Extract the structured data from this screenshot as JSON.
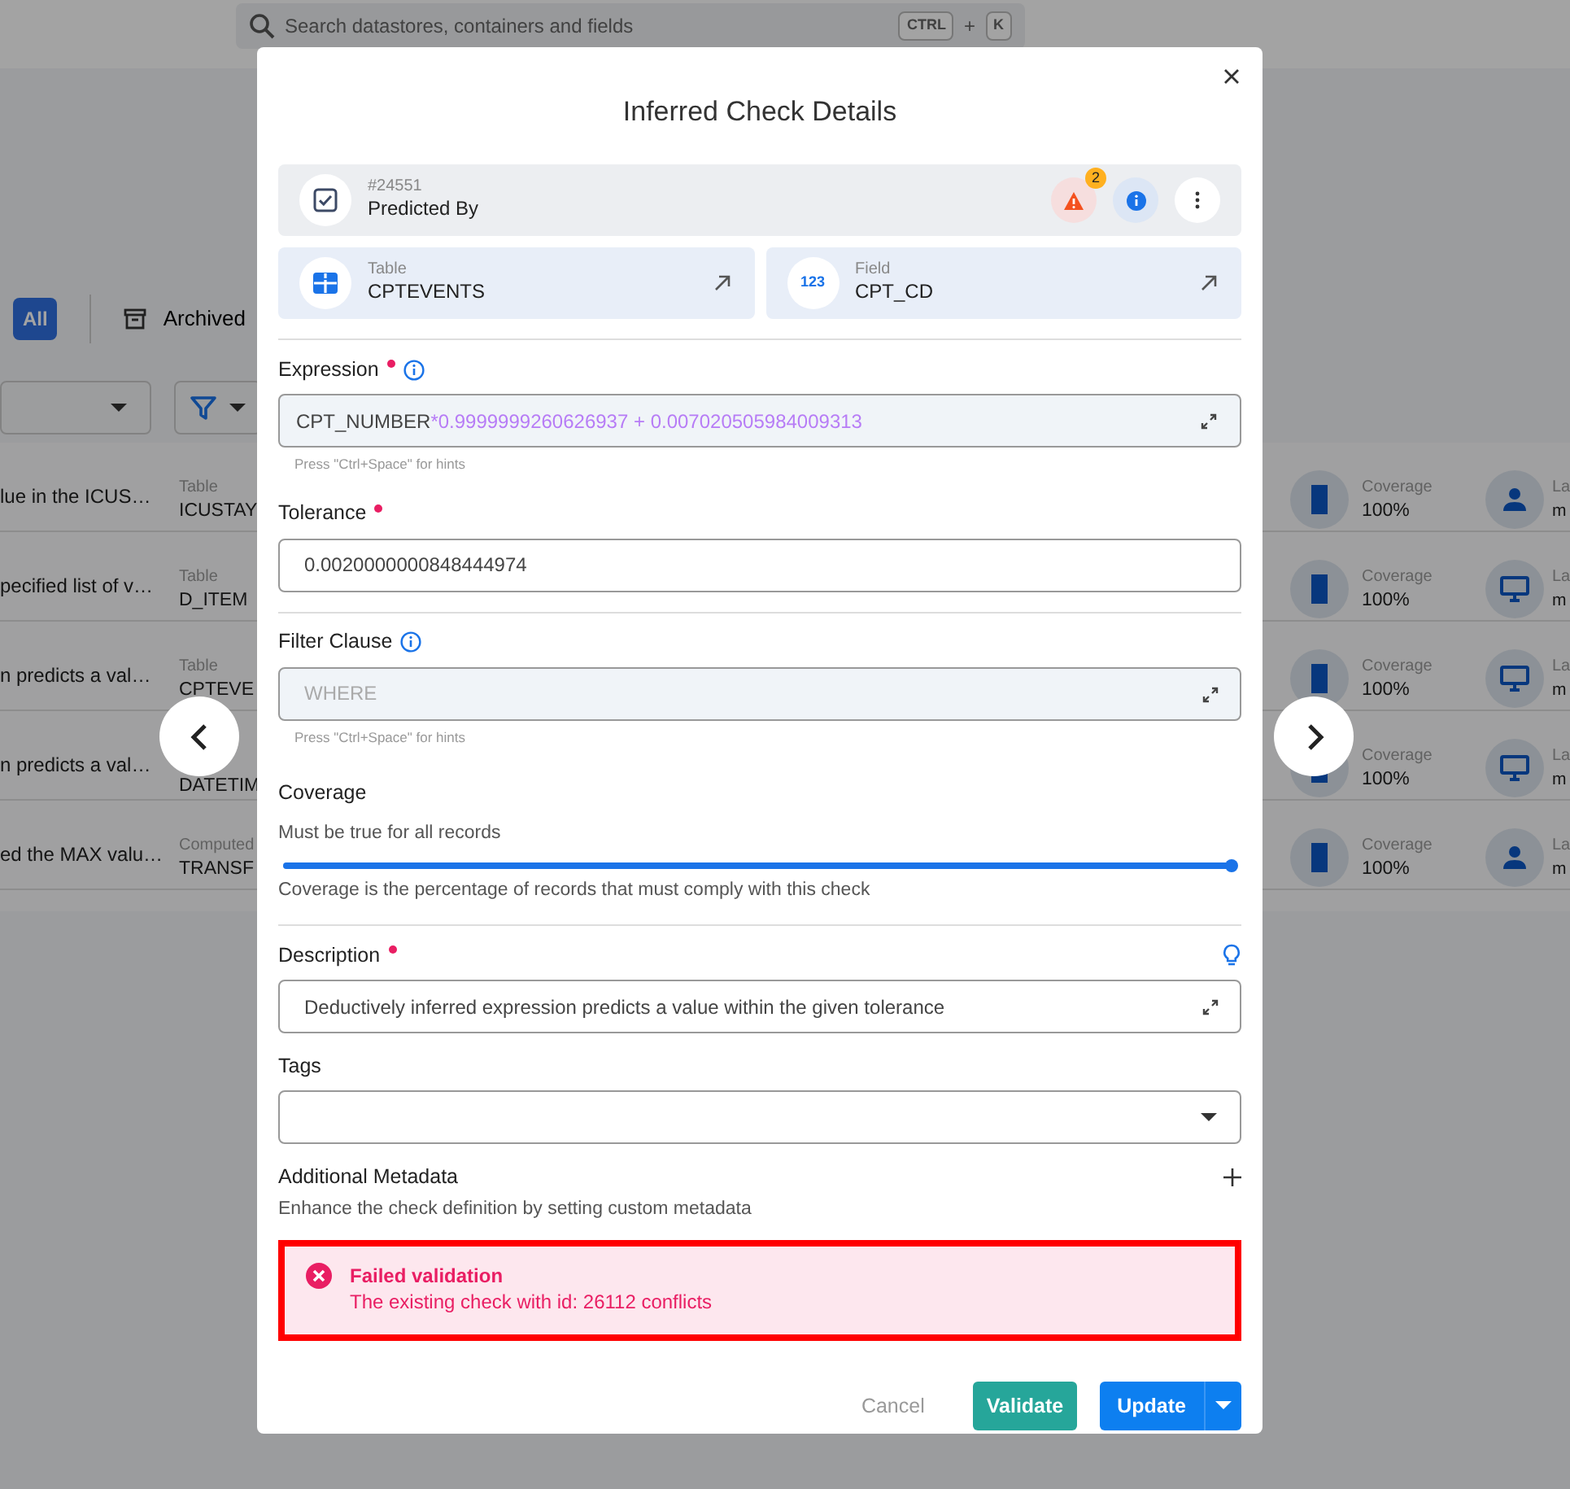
{
  "background": {
    "search": {
      "placeholder": "Search datastores, containers and fields",
      "keys": [
        "CTRL",
        "K"
      ],
      "joiner": "+"
    },
    "filters": [
      {
        "label": "All",
        "kind": "pill",
        "selected": true
      },
      {
        "label": "Archived",
        "kind": "archive",
        "selected": false
      }
    ],
    "rows": [
      {
        "kind": "person",
        "description": "lue in the ICUS…",
        "container_type": "Table",
        "container": "ICUSTAY",
        "coverage_label": "Coverage",
        "coverage": "100%",
        "user_label": "La",
        "user_value": "m"
      },
      {
        "kind": "monitor",
        "description": "pecified list of v…",
        "container_type": "Table",
        "container": "D_ITEM",
        "coverage_label": "Coverage",
        "coverage": "100%",
        "user_label": "La",
        "user_value": "m"
      },
      {
        "kind": "monitor",
        "description": "n predicts a val…",
        "container_type": "Table",
        "container": "CPTEVE",
        "coverage_label": "Coverage",
        "coverage": "100%",
        "user_label": "La",
        "user_value": "m"
      },
      {
        "kind": "monitor",
        "description": "n predicts a val…",
        "container": "DATETIM",
        "coverage_label": "Coverage",
        "coverage": "100%",
        "user_label": "La",
        "user_value": "m"
      },
      {
        "kind": "person",
        "description": "ed the MAX valu…",
        "container_type": "Computed",
        "container": "TRANSF",
        "coverage_label": "Coverage",
        "coverage": "100%",
        "user_label": "La",
        "user_value": "m"
      }
    ]
  },
  "modal": {
    "title": "Inferred Check Details",
    "check": {
      "id": "#24551",
      "name": "Predicted By",
      "alert_count": "2"
    },
    "links": [
      {
        "kind": "table",
        "label": "Table",
        "value": "CPTEVENTS"
      },
      {
        "kind": "field",
        "label": "Field",
        "value": "CPT_CD",
        "icon_text": "123"
      }
    ],
    "expression": {
      "label": "Expression",
      "required": true,
      "info": true,
      "tokens": [
        {
          "kind": "identifier",
          "text": "CPT_NUMBER"
        },
        {
          "kind": "literal",
          "text": "*0.9999999260626937 + 0.007020505984009313"
        }
      ],
      "hint": "Press \"Ctrl+Space\" for hints"
    },
    "tolerance": {
      "label": "Tolerance",
      "required": true,
      "value": "0.0020000000848444974"
    },
    "filter_clause": {
      "label": "Filter Clause",
      "info": true,
      "placeholder": "WHERE",
      "hint": "Press \"Ctrl+Space\" for hints"
    },
    "coverage": {
      "label": "Coverage",
      "subtitle": "Must be true for all records",
      "level": 1,
      "caption": "Coverage is the percentage of records that must comply with this check"
    },
    "description": {
      "label": "Description",
      "required": true,
      "value": "Deductively inferred expression predicts a value within the given tolerance"
    },
    "tags": {
      "label": "Tags"
    },
    "additional_metadata": {
      "title": "Additional Metadata",
      "subtitle": "Enhance the check definition by setting custom metadata"
    },
    "alert": {
      "title": "Failed validation",
      "message": "The existing check with id: 26112 conflicts",
      "highlighted": true
    },
    "buttons": [
      {
        "kind": "cancel",
        "label": "Cancel"
      },
      {
        "kind": "validate",
        "label": "Validate"
      },
      {
        "kind": "update",
        "label": "Update"
      }
    ]
  }
}
